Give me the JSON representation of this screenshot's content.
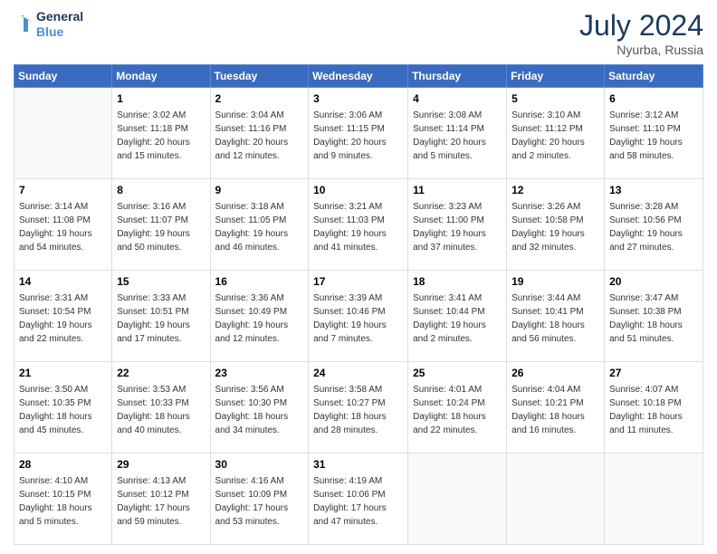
{
  "header": {
    "logo_line1": "General",
    "logo_line2": "Blue",
    "month_year": "July 2024",
    "location": "Nyurba, Russia"
  },
  "weekdays": [
    "Sunday",
    "Monday",
    "Tuesday",
    "Wednesday",
    "Thursday",
    "Friday",
    "Saturday"
  ],
  "weeks": [
    [
      {
        "day": "",
        "info": ""
      },
      {
        "day": "1",
        "info": "Sunrise: 3:02 AM\nSunset: 11:18 PM\nDaylight: 20 hours\nand 15 minutes."
      },
      {
        "day": "2",
        "info": "Sunrise: 3:04 AM\nSunset: 11:16 PM\nDaylight: 20 hours\nand 12 minutes."
      },
      {
        "day": "3",
        "info": "Sunrise: 3:06 AM\nSunset: 11:15 PM\nDaylight: 20 hours\nand 9 minutes."
      },
      {
        "day": "4",
        "info": "Sunrise: 3:08 AM\nSunset: 11:14 PM\nDaylight: 20 hours\nand 5 minutes."
      },
      {
        "day": "5",
        "info": "Sunrise: 3:10 AM\nSunset: 11:12 PM\nDaylight: 20 hours\nand 2 minutes."
      },
      {
        "day": "6",
        "info": "Sunrise: 3:12 AM\nSunset: 11:10 PM\nDaylight: 19 hours\nand 58 minutes."
      }
    ],
    [
      {
        "day": "7",
        "info": "Sunrise: 3:14 AM\nSunset: 11:08 PM\nDaylight: 19 hours\nand 54 minutes."
      },
      {
        "day": "8",
        "info": "Sunrise: 3:16 AM\nSunset: 11:07 PM\nDaylight: 19 hours\nand 50 minutes."
      },
      {
        "day": "9",
        "info": "Sunrise: 3:18 AM\nSunset: 11:05 PM\nDaylight: 19 hours\nand 46 minutes."
      },
      {
        "day": "10",
        "info": "Sunrise: 3:21 AM\nSunset: 11:03 PM\nDaylight: 19 hours\nand 41 minutes."
      },
      {
        "day": "11",
        "info": "Sunrise: 3:23 AM\nSunset: 11:00 PM\nDaylight: 19 hours\nand 37 minutes."
      },
      {
        "day": "12",
        "info": "Sunrise: 3:26 AM\nSunset: 10:58 PM\nDaylight: 19 hours\nand 32 minutes."
      },
      {
        "day": "13",
        "info": "Sunrise: 3:28 AM\nSunset: 10:56 PM\nDaylight: 19 hours\nand 27 minutes."
      }
    ],
    [
      {
        "day": "14",
        "info": "Sunrise: 3:31 AM\nSunset: 10:54 PM\nDaylight: 19 hours\nand 22 minutes."
      },
      {
        "day": "15",
        "info": "Sunrise: 3:33 AM\nSunset: 10:51 PM\nDaylight: 19 hours\nand 17 minutes."
      },
      {
        "day": "16",
        "info": "Sunrise: 3:36 AM\nSunset: 10:49 PM\nDaylight: 19 hours\nand 12 minutes."
      },
      {
        "day": "17",
        "info": "Sunrise: 3:39 AM\nSunset: 10:46 PM\nDaylight: 19 hours\nand 7 minutes."
      },
      {
        "day": "18",
        "info": "Sunrise: 3:41 AM\nSunset: 10:44 PM\nDaylight: 19 hours\nand 2 minutes."
      },
      {
        "day": "19",
        "info": "Sunrise: 3:44 AM\nSunset: 10:41 PM\nDaylight: 18 hours\nand 56 minutes."
      },
      {
        "day": "20",
        "info": "Sunrise: 3:47 AM\nSunset: 10:38 PM\nDaylight: 18 hours\nand 51 minutes."
      }
    ],
    [
      {
        "day": "21",
        "info": "Sunrise: 3:50 AM\nSunset: 10:35 PM\nDaylight: 18 hours\nand 45 minutes."
      },
      {
        "day": "22",
        "info": "Sunrise: 3:53 AM\nSunset: 10:33 PM\nDaylight: 18 hours\nand 40 minutes."
      },
      {
        "day": "23",
        "info": "Sunrise: 3:56 AM\nSunset: 10:30 PM\nDaylight: 18 hours\nand 34 minutes."
      },
      {
        "day": "24",
        "info": "Sunrise: 3:58 AM\nSunset: 10:27 PM\nDaylight: 18 hours\nand 28 minutes."
      },
      {
        "day": "25",
        "info": "Sunrise: 4:01 AM\nSunset: 10:24 PM\nDaylight: 18 hours\nand 22 minutes."
      },
      {
        "day": "26",
        "info": "Sunrise: 4:04 AM\nSunset: 10:21 PM\nDaylight: 18 hours\nand 16 minutes."
      },
      {
        "day": "27",
        "info": "Sunrise: 4:07 AM\nSunset: 10:18 PM\nDaylight: 18 hours\nand 11 minutes."
      }
    ],
    [
      {
        "day": "28",
        "info": "Sunrise: 4:10 AM\nSunset: 10:15 PM\nDaylight: 18 hours\nand 5 minutes."
      },
      {
        "day": "29",
        "info": "Sunrise: 4:13 AM\nSunset: 10:12 PM\nDaylight: 17 hours\nand 59 minutes."
      },
      {
        "day": "30",
        "info": "Sunrise: 4:16 AM\nSunset: 10:09 PM\nDaylight: 17 hours\nand 53 minutes."
      },
      {
        "day": "31",
        "info": "Sunrise: 4:19 AM\nSunset: 10:06 PM\nDaylight: 17 hours\nand 47 minutes."
      },
      {
        "day": "",
        "info": ""
      },
      {
        "day": "",
        "info": ""
      },
      {
        "day": "",
        "info": ""
      }
    ]
  ]
}
